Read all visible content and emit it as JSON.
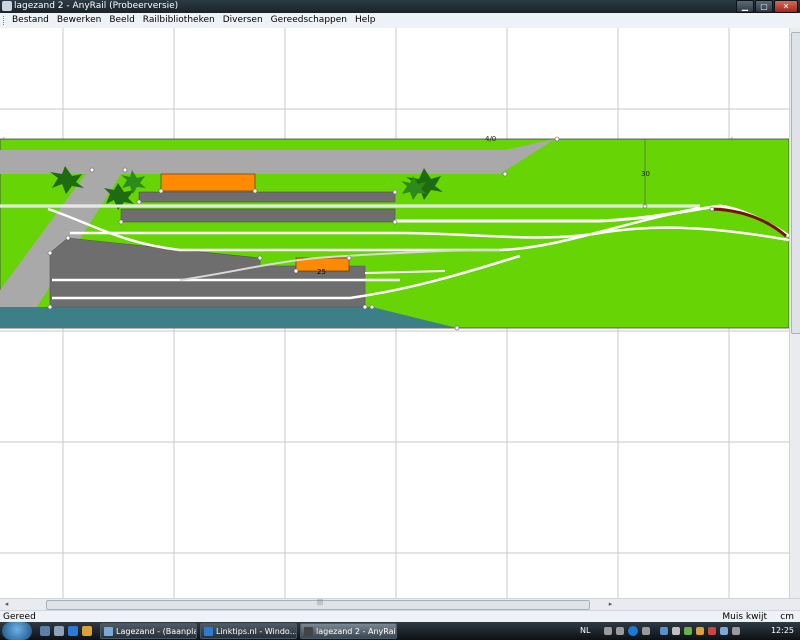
{
  "window": {
    "title": "lagezand 2 - AnyRail (Probeerversie)",
    "buttons": [
      "minimize",
      "maximize",
      "close"
    ]
  },
  "menu": {
    "items": [
      "Bestand",
      "Bewerken",
      "Beeld",
      "Railbibliotheken",
      "Diversen",
      "Gereedschappen",
      "Help"
    ]
  },
  "layout": {
    "measure_top": "4/0",
    "measure_right": "30",
    "platform_label": "25",
    "colors": {
      "grass": "#66d405",
      "road": "#a9a9a9",
      "platform_gray": "#6e6e6e",
      "building": "#ff8a00",
      "water": "#3d7f86",
      "rail": "#ffffff",
      "selected_track": "#7a1010"
    }
  },
  "status": {
    "left": "Gereed",
    "right_status": "Muis kwijt",
    "unit": "cm"
  },
  "taskbar": {
    "tasks": [
      "Lagezand - (Baanpla...",
      "Linktips.nl - Windo...",
      "lagezand 2 - AnyRail..."
    ],
    "language": "NL",
    "clock": "12:25"
  },
  "icons": {
    "start": "windows-orb-icon",
    "quick_launch": [
      "show-desktop-icon",
      "switch-windows-icon",
      "ie-icon",
      "outlook-icon"
    ]
  }
}
